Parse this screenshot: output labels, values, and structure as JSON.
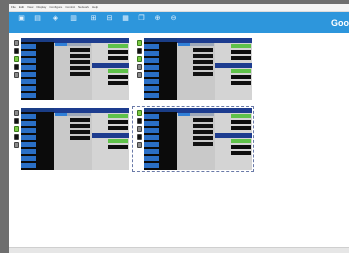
{
  "app": {
    "brand": "Goo",
    "menu": [
      "File",
      "Edit",
      "View",
      "Display",
      "Configure",
      "Control",
      "Network",
      "Help"
    ]
  },
  "toolbar": {
    "tools": [
      {
        "name": "open-tool",
        "glyph": "▣"
      },
      {
        "name": "save-tool",
        "glyph": "▤"
      },
      {
        "name": "connect-tool",
        "glyph": "◈"
      },
      {
        "name": "device-tool",
        "glyph": "▥"
      },
      {
        "name": "group-tool",
        "glyph": "⊞"
      },
      {
        "name": "layout-tool",
        "glyph": "⊟"
      },
      {
        "name": "arrange-tool",
        "glyph": "▦"
      },
      {
        "name": "copy-tool",
        "glyph": "❐"
      },
      {
        "name": "zoom-in-tool",
        "glyph": "⊕"
      },
      {
        "name": "zoom-out-tool",
        "glyph": "⊖"
      }
    ]
  },
  "groups": [
    {
      "id": "group-1",
      "selected": false
    },
    {
      "id": "group-2",
      "selected": false
    },
    {
      "id": "group-3",
      "selected": false
    },
    {
      "id": "group-4",
      "selected": true
    }
  ],
  "colors": {
    "toolbar": "#2d96dc",
    "panel_header": "#1d3c8f",
    "name_button": "#2a6fc6",
    "meter_text": "#4fd04f"
  }
}
